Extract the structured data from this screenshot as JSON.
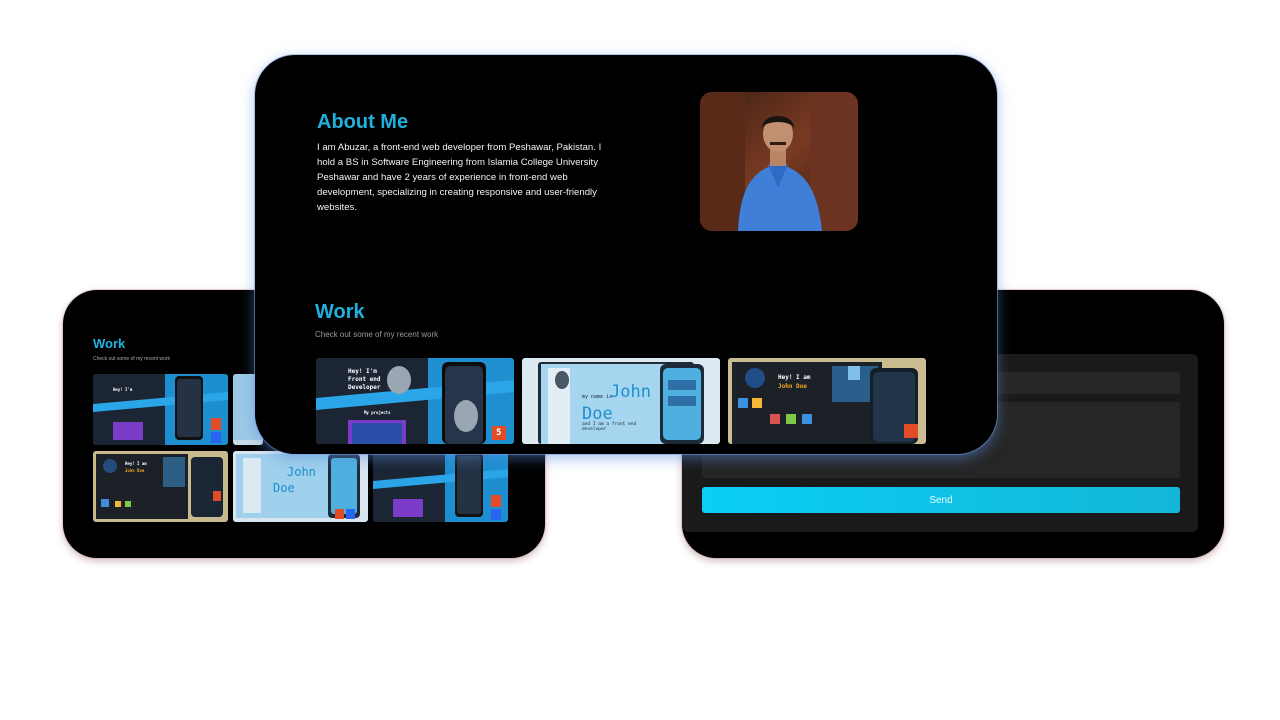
{
  "about": {
    "title": "About Me",
    "text": "I am Abuzar, a front-end web developer from Peshawar, Pakistan. I hold a BS in Software Engineering from Islamia College University Peshawar and have 2 years of experience in front-end web development, specializing in creating responsive and user-friendly websites."
  },
  "work": {
    "title": "Work",
    "subtitle": "Check out some of my recent work"
  },
  "contact": {
    "send_label": "Send"
  },
  "thumbs": {
    "hey_im": "Hey! I'm",
    "front_end": "Front end",
    "developer": "Developer",
    "my_projects": "My projects",
    "my_name_is": "my name is",
    "john": "John",
    "doe": "Doe",
    "front_and": "and I am a front end developer",
    "hey_i_am": "Hey! I am",
    "john_doe": "John Doe",
    "html_badge": "5",
    "css_badge": "3"
  },
  "colors": {
    "accent": "#1fb0dd",
    "send": "#0bcff5",
    "background": "#000000"
  }
}
